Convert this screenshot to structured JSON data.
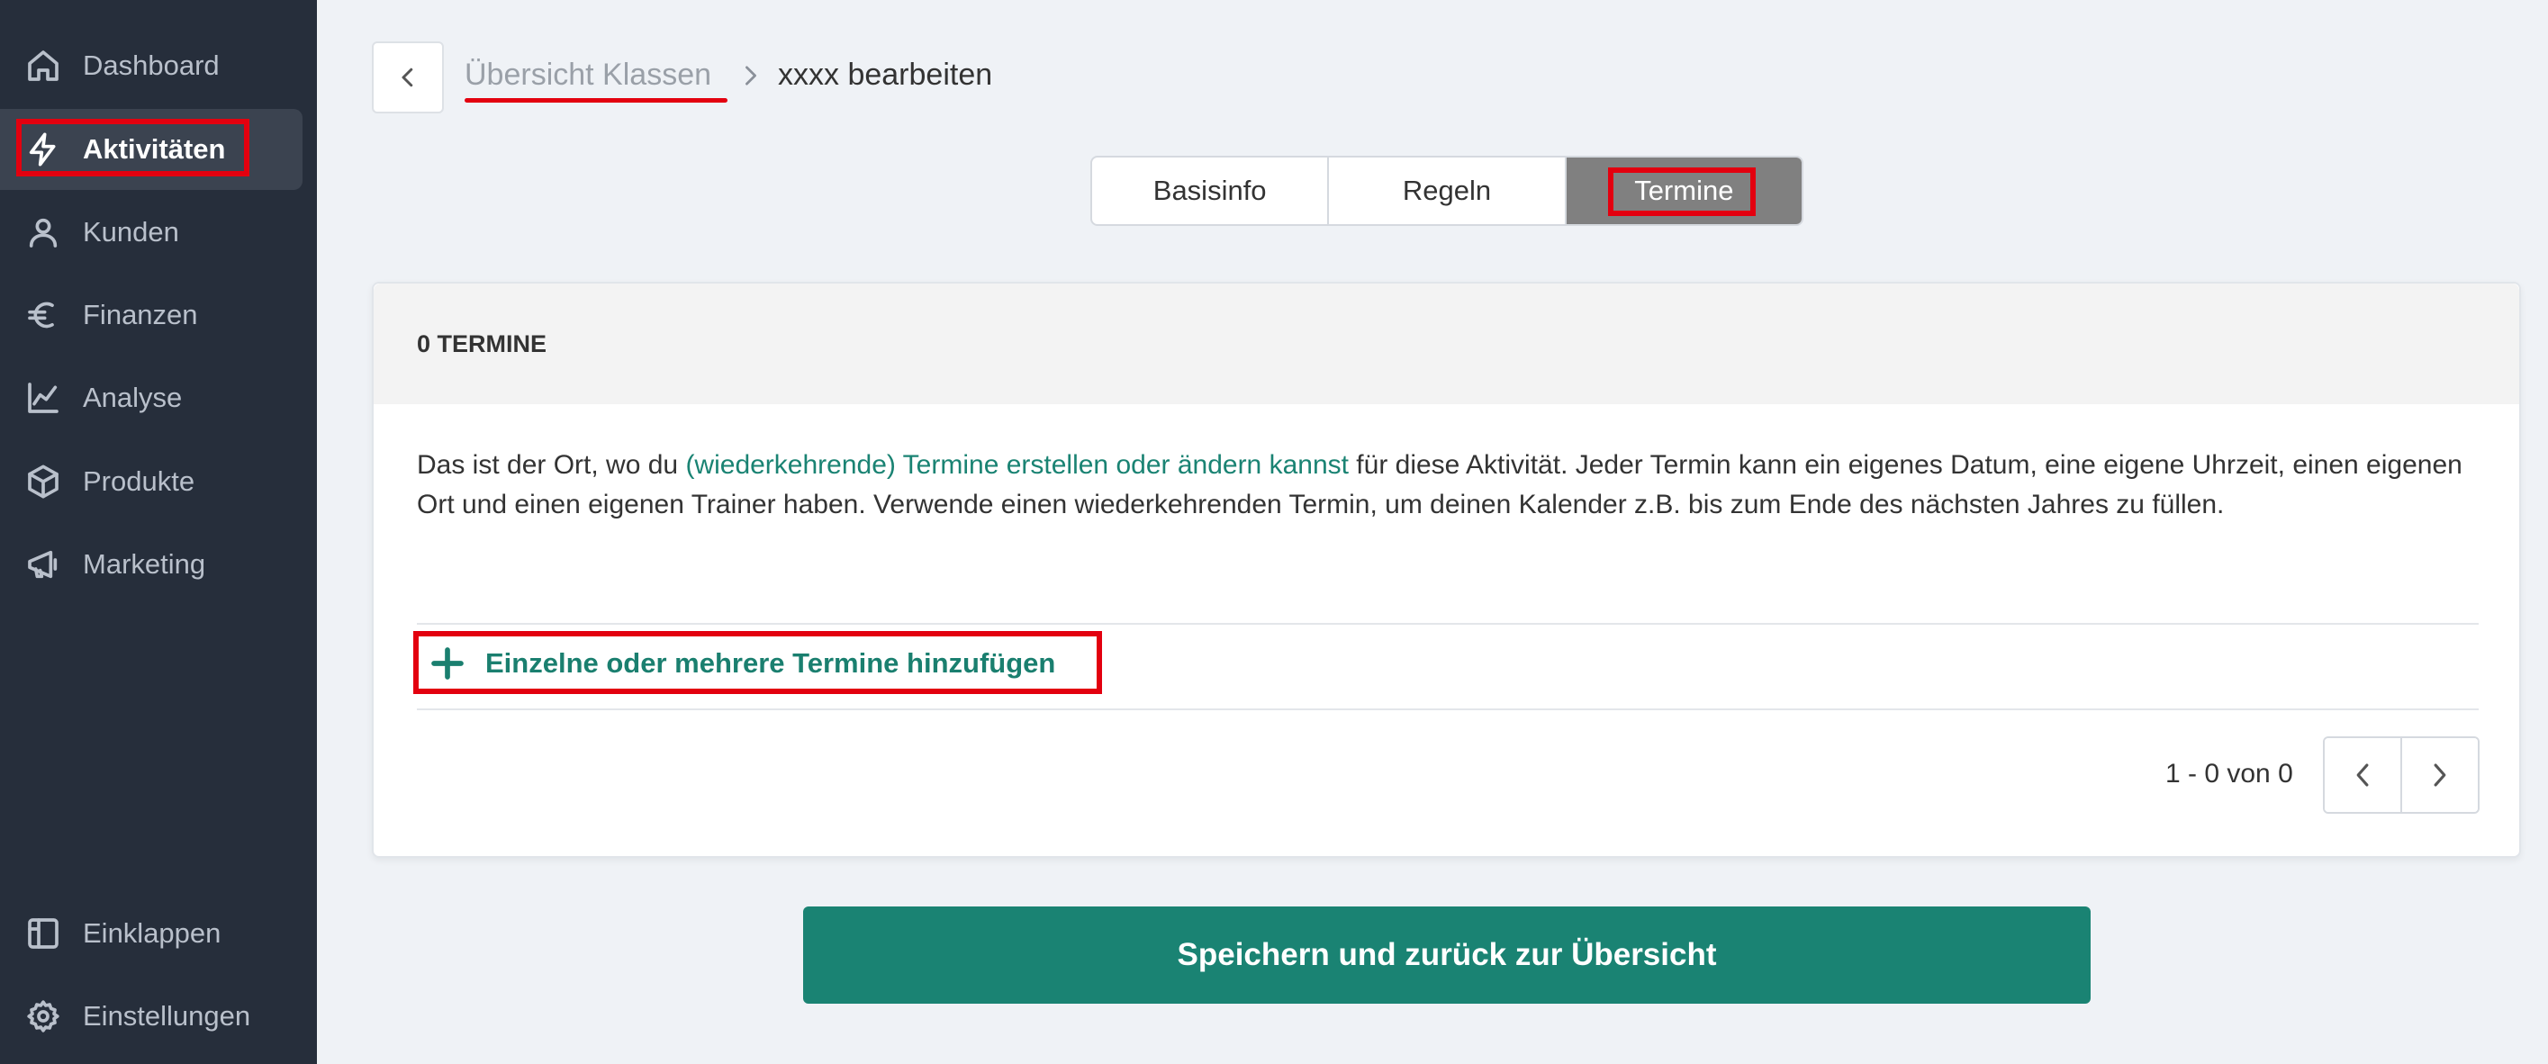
{
  "sidebar": {
    "items": [
      {
        "label": "Dashboard",
        "icon": "home-icon"
      },
      {
        "label": "Aktivitäten",
        "icon": "lightning-icon"
      },
      {
        "label": "Kunden",
        "icon": "user-icon"
      },
      {
        "label": "Finanzen",
        "icon": "euro-icon"
      },
      {
        "label": "Analyse",
        "icon": "line-chart-icon"
      },
      {
        "label": "Produkte",
        "icon": "box-icon"
      },
      {
        "label": "Marketing",
        "icon": "megaphone-icon"
      }
    ],
    "bottom": [
      {
        "label": "Einklappen",
        "icon": "collapse-panel-icon"
      },
      {
        "label": "Einstellungen",
        "icon": "gear-icon"
      }
    ]
  },
  "header": {
    "breadcrumb_link": "Übersicht Klassen",
    "breadcrumb_current": "xxxx bearbeiten"
  },
  "tabs": [
    "Basisinfo",
    "Regeln",
    "Termine"
  ],
  "card": {
    "title": "0 TERMINE",
    "desc_before": "Das ist der Ort, wo du ",
    "desc_link": "(wiederkehrende) Termine erstellen oder ändern kannst",
    "desc_after": " für diese Aktivität. Jeder Termin kann ein eigenes Datum, eine eigene Uhrzeit, einen eigenen Ort und einen eigenen Trainer haben. Verwende einen wiederkehrenden Termin, um deinen Kalender z.B. bis zum Ende des nächsten Jahres zu füllen.",
    "add_label": "Einzelne oder mehrere Termine hinzufügen",
    "pager_text": "1 - 0 von 0"
  },
  "save_label": "Speichern und zurück zur Übersicht",
  "colors": {
    "sidebar_bg": "#262e3b",
    "accent_green": "#1a8373",
    "annotation_red": "#e3000f",
    "active_tab": "#808080"
  }
}
